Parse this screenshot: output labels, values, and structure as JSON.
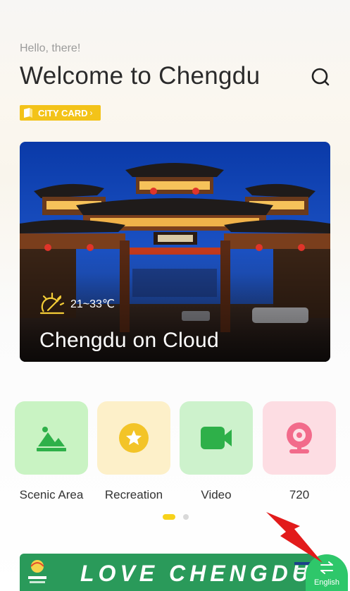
{
  "header": {
    "greeting": "Hello, there!",
    "title": "Welcome to Chengdu",
    "search_icon": "search-icon"
  },
  "city_card": {
    "label": "CITY CARD",
    "chevron": "›",
    "color": "#f3c319"
  },
  "hero": {
    "caption": "Chengdu on Cloud",
    "weather_icon": "sun-icon",
    "temperature": "21~33℃"
  },
  "categories": [
    {
      "label": "Scenic Area",
      "icon": "mountain-icon",
      "bg": "#c9f3c3"
    },
    {
      "label": "Recreation",
      "icon": "star-icon",
      "bg": "#fdf0c9"
    },
    {
      "label": "Video",
      "icon": "video-camera-icon",
      "bg": "#cdf2cc"
    },
    {
      "label": "720",
      "icon": "webcam-icon",
      "bg": "#fddde3"
    }
  ],
  "pager": {
    "pages": 2,
    "active": 1
  },
  "banner": {
    "text": "LOVE CHENGDU"
  },
  "language_button": {
    "label": "English",
    "icon": "swap-arrows-icon",
    "color": "#2ec76a"
  }
}
